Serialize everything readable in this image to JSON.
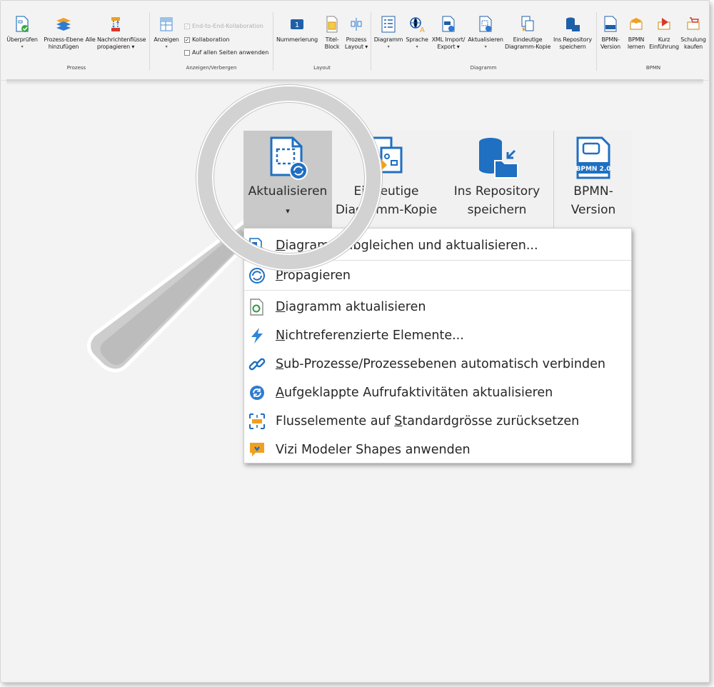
{
  "ribbon": {
    "groups": {
      "prozess": "Prozess",
      "anzeigen": "Anzeigen/Verbergen",
      "layout": "Layout",
      "diagramm": "Diagramm",
      "bpmn": "BPMN"
    },
    "buttons": {
      "ueberpruefen": "Überprüfen",
      "prozess_ebene_1": "Prozess-Ebene",
      "prozess_ebene_2": "hinzufügen",
      "alle": "Alle",
      "nachrichtenfluesse_1": "Nachrichtenflüsse",
      "nachrichtenfluesse_2": "propagieren",
      "anzeigen": "Anzeigen",
      "nummerierung": "Nummerierung",
      "titel_block_1": "Titel-",
      "titel_block_2": "Block",
      "prozess_layout_1": "Prozess",
      "prozess_layout_2": "Layout",
      "diagramm": "Diagramm",
      "sprache": "Sprache",
      "xml_1": "XML Import/",
      "xml_2": "Export",
      "aktualisieren": "Aktualisieren",
      "eindeutige_1": "Eindeutige",
      "eindeutige_2": "Diagramm-Kopie",
      "repo_1": "Ins Repository",
      "repo_2": "speichern",
      "bpmn_version_1": "BPMN-",
      "bpmn_version_2": "Version",
      "bpmn_lernen_1": "BPMN",
      "bpmn_lernen_2": "lernen",
      "kurz_1": "Kurz",
      "kurz_2": "Einführung",
      "schulung_1": "Schulung",
      "schulung_2": "kaufen"
    },
    "checks": {
      "end_to_end": "End-to-End-Kollaboration",
      "kollaboration": "Kollaboration",
      "alle_seiten": "Auf allen Seiten anwenden"
    }
  },
  "zoom": {
    "aktualisieren": "Aktualisieren",
    "eindeutige_1": "Eindeutige",
    "eindeutige_2": "Diagramm-Kopie",
    "repo_1": "Ins Repository",
    "repo_2": "speichern",
    "bpmn_1": "BPMN-",
    "bpmn_2": "Version",
    "bpmn_badge": "BPMN 2.0"
  },
  "menu": {
    "items": [
      {
        "pre": "",
        "u": "D",
        "post": "iagramm abgleichen und aktualisieren..."
      },
      {
        "pre": "",
        "u": "P",
        "post": "ropagieren"
      },
      {
        "pre": "",
        "u": "D",
        "post": "iagramm aktualisieren"
      },
      {
        "pre": "",
        "u": "N",
        "post": "ichtreferenzierte Elemente..."
      },
      {
        "pre": "",
        "u": "S",
        "post": "ub-Prozesse/Prozessebenen automatisch verbinden"
      },
      {
        "pre": "",
        "u": "A",
        "post": "ufgeklappte Aufrufaktivitäten aktualisieren"
      },
      {
        "pre": "Flusselemente auf ",
        "u": "S",
        "post": "tandardgrösse zurücksetzen"
      },
      {
        "pre": "Vizi Modeler Shapes anwenden",
        "u": "",
        "post": ""
      }
    ]
  },
  "colors": {
    "accent_blue": "#1f6fc2",
    "accent_orange": "#f0a020",
    "ribbon_bg": "#f3f3f3",
    "active_bg": "#c9c9c9"
  }
}
